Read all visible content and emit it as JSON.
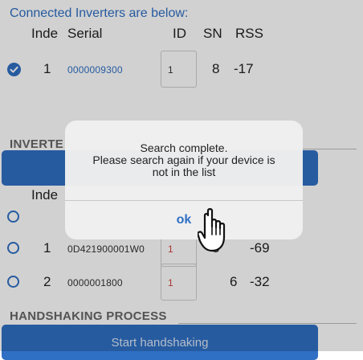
{
  "connected": {
    "title": "Connected Inverters are below:",
    "headers": {
      "index": "Inde",
      "serial": "Serial",
      "id": "ID",
      "sn": "SN",
      "rss": "RSS"
    },
    "rows": [
      {
        "index": "1",
        "serial": "0000009300",
        "id": "1",
        "sn": "8",
        "rss": "-17",
        "checked": true
      }
    ]
  },
  "inverter_section": {
    "title": "INVERTE",
    "headers": {
      "index": "Inde"
    },
    "rows": [
      {
        "index": "",
        "serial": "",
        "id": "",
        "sn": "",
        "rss": ""
      },
      {
        "index": "1",
        "serial": "0D421900001W0",
        "id": "1",
        "sn": "5",
        "rss": "-69"
      },
      {
        "index": "2",
        "serial": "0000001800",
        "id": "1",
        "sn": "6",
        "rss": "-32"
      }
    ]
  },
  "handshaking": {
    "title": "HANDSHAKING PROCESS",
    "button_label": "Start handshaking"
  },
  "dialog": {
    "line1": "Search complete.",
    "line2": "Please search again if your device is",
    "line3": "not in the list",
    "ok_label": "ok"
  },
  "colors": {
    "accent": "#2f6fc4",
    "id_red": "#d0463c"
  },
  "icons": {
    "checked": "check-circle-icon",
    "radio": "radio-circle-icon",
    "pointer": "hand-pointer-icon"
  }
}
